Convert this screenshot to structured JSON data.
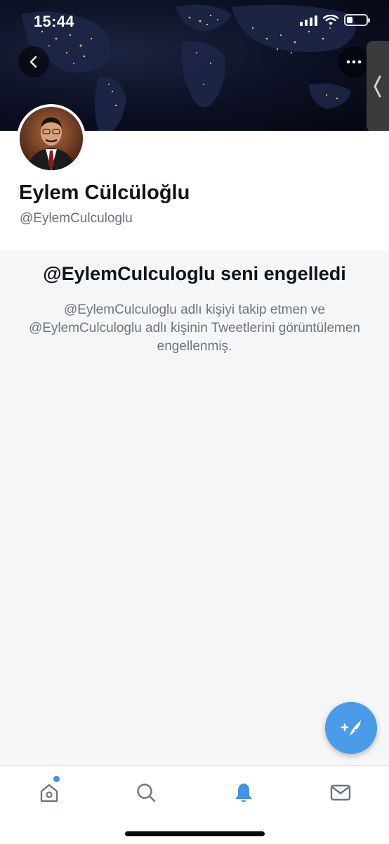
{
  "status_bar": {
    "time": "15:44",
    "icons": [
      "signal-icon",
      "wifi-icon",
      "battery-icon"
    ]
  },
  "header": {
    "back_icon": "chevron-left-icon",
    "more_icon": "ellipsis-icon",
    "side_handle_icon": "chevron-left-icon"
  },
  "profile": {
    "display_name": "Eylem Cülcüloğlu",
    "handle": "@EylemCulculoglu"
  },
  "blocked": {
    "title": "@EylemCulculoglu seni engelledi",
    "description": "@EylemCulculoglu adlı kişiyi takip etmen ve @EylemCulculoglu adlı kişinin Tweetlerini görüntülemen engellenmiş."
  },
  "fab": {
    "icon": "compose-tweet-icon"
  },
  "tabbar": {
    "tabs": [
      {
        "name": "home",
        "icon": "home-icon",
        "has_badge": true
      },
      {
        "name": "search",
        "icon": "search-icon",
        "has_badge": false
      },
      {
        "name": "notifications",
        "icon": "bell-icon",
        "active": true
      },
      {
        "name": "messages",
        "icon": "mail-icon",
        "has_badge": false
      }
    ]
  },
  "colors": {
    "accent": "#4a9be8",
    "active_tab": "#3f94e8",
    "inactive_tab": "#6b7580",
    "background": "#f5f6f8"
  }
}
